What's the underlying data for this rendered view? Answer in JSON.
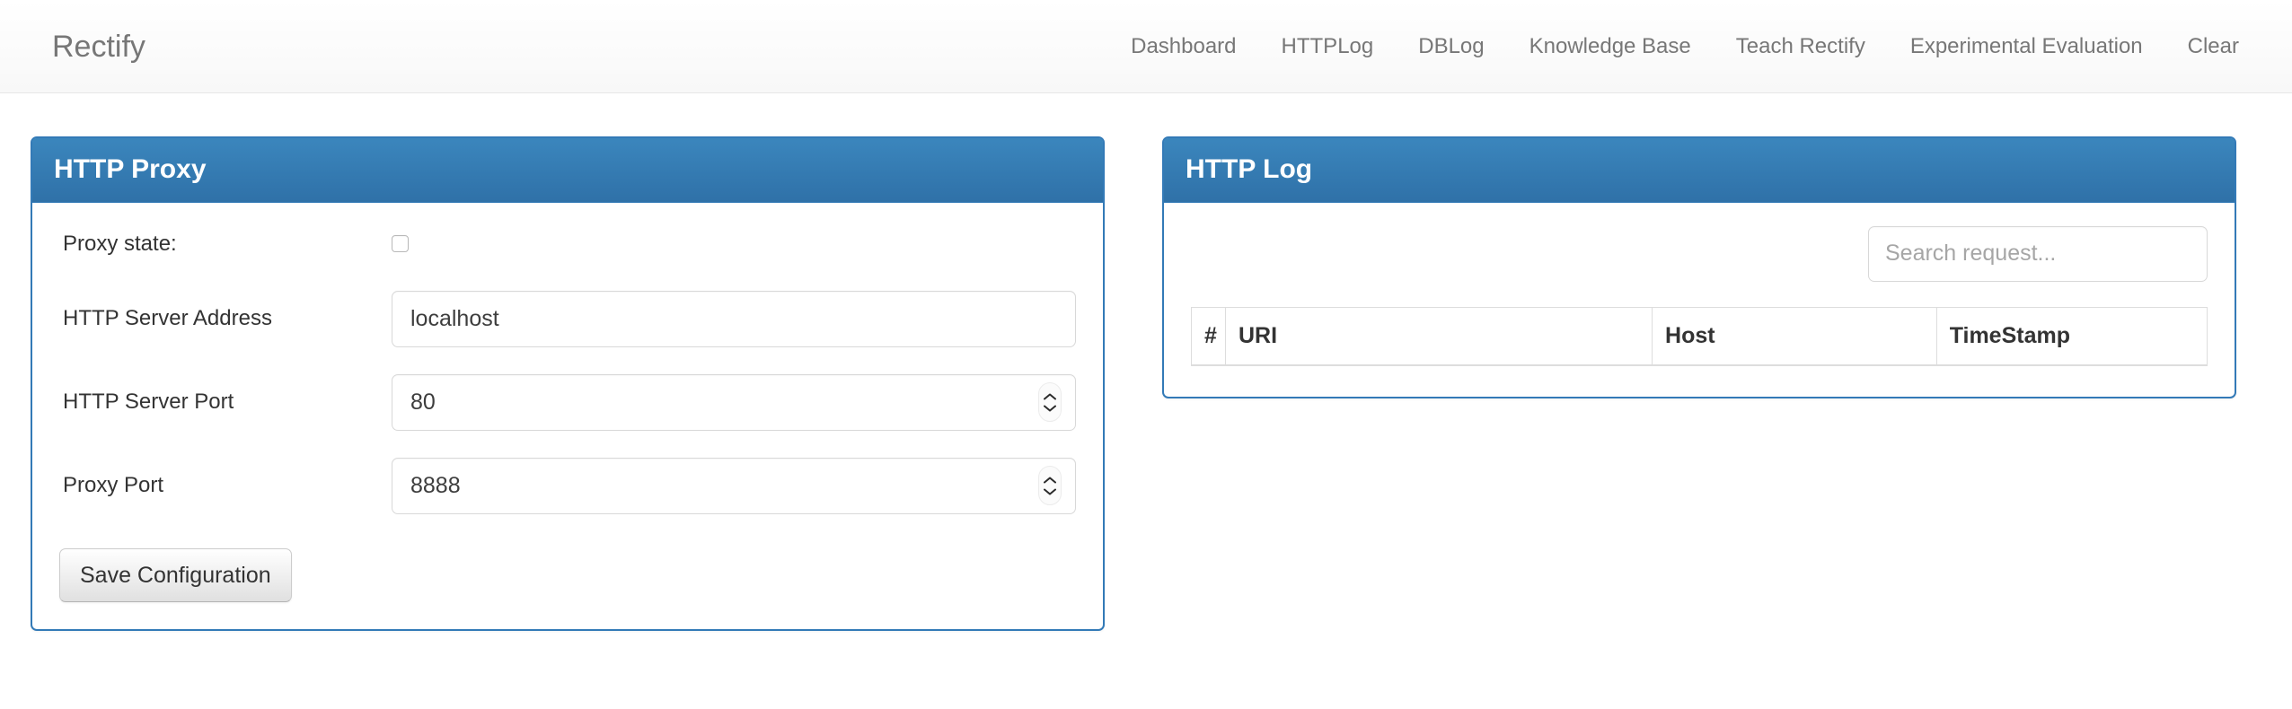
{
  "navbar": {
    "brand": "Rectify",
    "links": [
      {
        "label": "Dashboard",
        "name": "nav-link-dashboard"
      },
      {
        "label": "HTTPLog",
        "name": "nav-link-httplog"
      },
      {
        "label": "DBLog",
        "name": "nav-link-dblog"
      },
      {
        "label": "Knowledge Base",
        "name": "nav-link-knowledge-base"
      },
      {
        "label": "Teach Rectify",
        "name": "nav-link-teach-rectify"
      },
      {
        "label": "Experimental Evaluation",
        "name": "nav-link-experimental-evaluation"
      },
      {
        "label": "Clear",
        "name": "nav-link-clear"
      }
    ]
  },
  "http_proxy_panel": {
    "title": "HTTP Proxy",
    "fields": {
      "proxy_state_label": "Proxy state:",
      "proxy_state_checked": false,
      "server_address_label": "HTTP Server Address",
      "server_address_value": "localhost",
      "server_port_label": "HTTP Server Port",
      "server_port_value": "80",
      "proxy_port_label": "Proxy Port",
      "proxy_port_value": "8888"
    },
    "save_button_label": "Save Configuration"
  },
  "http_log_panel": {
    "title": "HTTP Log",
    "search_placeholder": "Search request...",
    "search_value": "",
    "table": {
      "columns": [
        "#",
        "URI",
        "Host",
        "TimeStamp"
      ],
      "rows": []
    }
  },
  "colors": {
    "panel_border": "#337ab7",
    "panel_heading_top": "#3b86bd",
    "panel_heading_bottom": "#2f71a8",
    "nav_text": "#777777",
    "body_text": "#333333",
    "input_border": "#d8d8d8",
    "table_border": "#dddddd"
  }
}
